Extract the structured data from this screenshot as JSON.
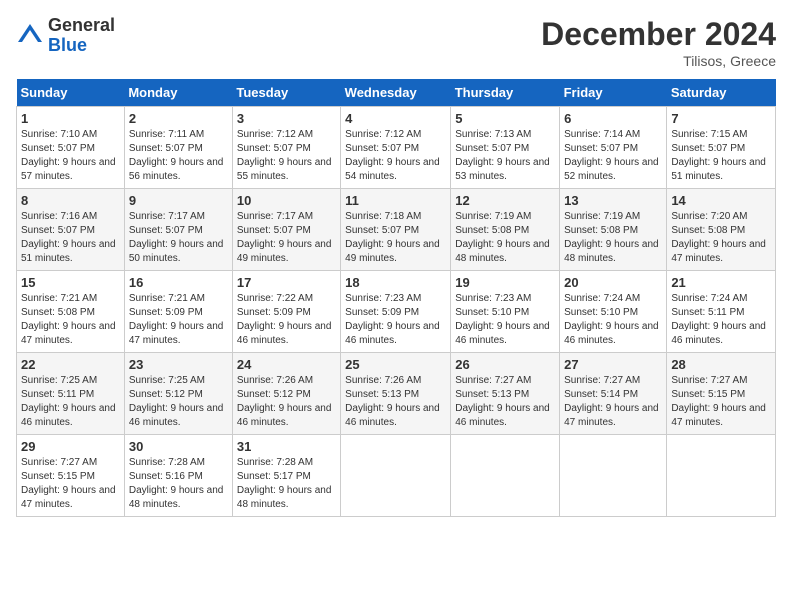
{
  "logo": {
    "general": "General",
    "blue": "Blue"
  },
  "title": "December 2024",
  "location": "Tilisos, Greece",
  "days_of_week": [
    "Sunday",
    "Monday",
    "Tuesday",
    "Wednesday",
    "Thursday",
    "Friday",
    "Saturday"
  ],
  "weeks": [
    [
      {
        "day": "1",
        "sunrise": "Sunrise: 7:10 AM",
        "sunset": "Sunset: 5:07 PM",
        "daylight": "Daylight: 9 hours and 57 minutes."
      },
      {
        "day": "2",
        "sunrise": "Sunrise: 7:11 AM",
        "sunset": "Sunset: 5:07 PM",
        "daylight": "Daylight: 9 hours and 56 minutes."
      },
      {
        "day": "3",
        "sunrise": "Sunrise: 7:12 AM",
        "sunset": "Sunset: 5:07 PM",
        "daylight": "Daylight: 9 hours and 55 minutes."
      },
      {
        "day": "4",
        "sunrise": "Sunrise: 7:12 AM",
        "sunset": "Sunset: 5:07 PM",
        "daylight": "Daylight: 9 hours and 54 minutes."
      },
      {
        "day": "5",
        "sunrise": "Sunrise: 7:13 AM",
        "sunset": "Sunset: 5:07 PM",
        "daylight": "Daylight: 9 hours and 53 minutes."
      },
      {
        "day": "6",
        "sunrise": "Sunrise: 7:14 AM",
        "sunset": "Sunset: 5:07 PM",
        "daylight": "Daylight: 9 hours and 52 minutes."
      },
      {
        "day": "7",
        "sunrise": "Sunrise: 7:15 AM",
        "sunset": "Sunset: 5:07 PM",
        "daylight": "Daylight: 9 hours and 51 minutes."
      }
    ],
    [
      {
        "day": "8",
        "sunrise": "Sunrise: 7:16 AM",
        "sunset": "Sunset: 5:07 PM",
        "daylight": "Daylight: 9 hours and 51 minutes."
      },
      {
        "day": "9",
        "sunrise": "Sunrise: 7:17 AM",
        "sunset": "Sunset: 5:07 PM",
        "daylight": "Daylight: 9 hours and 50 minutes."
      },
      {
        "day": "10",
        "sunrise": "Sunrise: 7:17 AM",
        "sunset": "Sunset: 5:07 PM",
        "daylight": "Daylight: 9 hours and 49 minutes."
      },
      {
        "day": "11",
        "sunrise": "Sunrise: 7:18 AM",
        "sunset": "Sunset: 5:07 PM",
        "daylight": "Daylight: 9 hours and 49 minutes."
      },
      {
        "day": "12",
        "sunrise": "Sunrise: 7:19 AM",
        "sunset": "Sunset: 5:08 PM",
        "daylight": "Daylight: 9 hours and 48 minutes."
      },
      {
        "day": "13",
        "sunrise": "Sunrise: 7:19 AM",
        "sunset": "Sunset: 5:08 PM",
        "daylight": "Daylight: 9 hours and 48 minutes."
      },
      {
        "day": "14",
        "sunrise": "Sunrise: 7:20 AM",
        "sunset": "Sunset: 5:08 PM",
        "daylight": "Daylight: 9 hours and 47 minutes."
      }
    ],
    [
      {
        "day": "15",
        "sunrise": "Sunrise: 7:21 AM",
        "sunset": "Sunset: 5:08 PM",
        "daylight": "Daylight: 9 hours and 47 minutes."
      },
      {
        "day": "16",
        "sunrise": "Sunrise: 7:21 AM",
        "sunset": "Sunset: 5:09 PM",
        "daylight": "Daylight: 9 hours and 47 minutes."
      },
      {
        "day": "17",
        "sunrise": "Sunrise: 7:22 AM",
        "sunset": "Sunset: 5:09 PM",
        "daylight": "Daylight: 9 hours and 46 minutes."
      },
      {
        "day": "18",
        "sunrise": "Sunrise: 7:23 AM",
        "sunset": "Sunset: 5:09 PM",
        "daylight": "Daylight: 9 hours and 46 minutes."
      },
      {
        "day": "19",
        "sunrise": "Sunrise: 7:23 AM",
        "sunset": "Sunset: 5:10 PM",
        "daylight": "Daylight: 9 hours and 46 minutes."
      },
      {
        "day": "20",
        "sunrise": "Sunrise: 7:24 AM",
        "sunset": "Sunset: 5:10 PM",
        "daylight": "Daylight: 9 hours and 46 minutes."
      },
      {
        "day": "21",
        "sunrise": "Sunrise: 7:24 AM",
        "sunset": "Sunset: 5:11 PM",
        "daylight": "Daylight: 9 hours and 46 minutes."
      }
    ],
    [
      {
        "day": "22",
        "sunrise": "Sunrise: 7:25 AM",
        "sunset": "Sunset: 5:11 PM",
        "daylight": "Daylight: 9 hours and 46 minutes."
      },
      {
        "day": "23",
        "sunrise": "Sunrise: 7:25 AM",
        "sunset": "Sunset: 5:12 PM",
        "daylight": "Daylight: 9 hours and 46 minutes."
      },
      {
        "day": "24",
        "sunrise": "Sunrise: 7:26 AM",
        "sunset": "Sunset: 5:12 PM",
        "daylight": "Daylight: 9 hours and 46 minutes."
      },
      {
        "day": "25",
        "sunrise": "Sunrise: 7:26 AM",
        "sunset": "Sunset: 5:13 PM",
        "daylight": "Daylight: 9 hours and 46 minutes."
      },
      {
        "day": "26",
        "sunrise": "Sunrise: 7:27 AM",
        "sunset": "Sunset: 5:13 PM",
        "daylight": "Daylight: 9 hours and 46 minutes."
      },
      {
        "day": "27",
        "sunrise": "Sunrise: 7:27 AM",
        "sunset": "Sunset: 5:14 PM",
        "daylight": "Daylight: 9 hours and 47 minutes."
      },
      {
        "day": "28",
        "sunrise": "Sunrise: 7:27 AM",
        "sunset": "Sunset: 5:15 PM",
        "daylight": "Daylight: 9 hours and 47 minutes."
      }
    ],
    [
      {
        "day": "29",
        "sunrise": "Sunrise: 7:27 AM",
        "sunset": "Sunset: 5:15 PM",
        "daylight": "Daylight: 9 hours and 47 minutes."
      },
      {
        "day": "30",
        "sunrise": "Sunrise: 7:28 AM",
        "sunset": "Sunset: 5:16 PM",
        "daylight": "Daylight: 9 hours and 48 minutes."
      },
      {
        "day": "31",
        "sunrise": "Sunrise: 7:28 AM",
        "sunset": "Sunset: 5:17 PM",
        "daylight": "Daylight: 9 hours and 48 minutes."
      },
      null,
      null,
      null,
      null
    ]
  ]
}
